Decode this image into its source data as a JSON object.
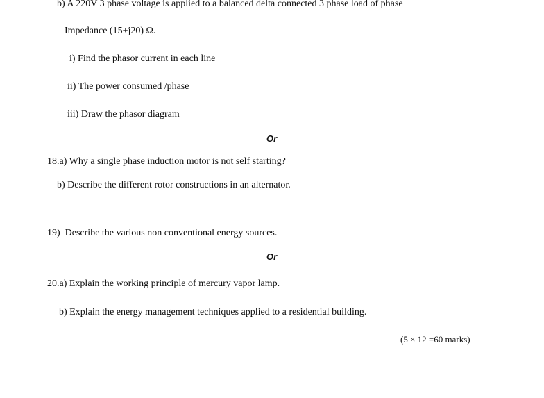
{
  "q17b": {
    "line1": "b) A 220V 3 phase voltage is applied to a balanced delta connected 3 phase load of phase",
    "line2": "Impedance (15+j20) Ω.",
    "part_i": "i) Find the phasor current in each line",
    "part_ii": "ii) The power consumed /phase",
    "part_iii": "iii) Draw the phasor diagram"
  },
  "or_1": "Or",
  "q18": {
    "a": "18.a) Why a single phase induction motor is not self starting?",
    "b": "b) Describe the different rotor constructions in an alternator."
  },
  "q19": "19)  Describe the various non conventional energy sources.",
  "or_2": "Or",
  "q20": {
    "a": "20.a) Explain the working principle of mercury vapor lamp.",
    "b": "b) Explain the energy management techniques applied to a residential building."
  },
  "marks": "(5 × 12 =60 marks)"
}
